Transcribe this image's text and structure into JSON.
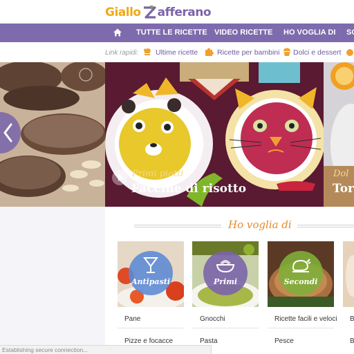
{
  "header": {
    "logo_part1": "Giallo",
    "logo_part2": "afferano",
    "brand_yellow": "#f0a818",
    "brand_purple": "#7b64a8"
  },
  "nav": {
    "home_icon": "home-icon",
    "items": [
      {
        "label": "TUTTE LE RICETTE"
      },
      {
        "label": "VIDEO RICETTE"
      },
      {
        "label": "HO VOGLIA DI"
      },
      {
        "label": "SO"
      }
    ],
    "background": "#7d6bad"
  },
  "quick_links": {
    "label": "Link rapidi:",
    "items": [
      {
        "label": "Ultime ricette",
        "icon": "chef-hat-icon"
      },
      {
        "label": "Ricette per bambini",
        "icon": "puzzle-icon"
      },
      {
        "label": "Dolci e dessert",
        "icon": "cupcake-icon"
      }
    ]
  },
  "carousel": {
    "main_category": "Primi piatti",
    "main_title": "Faccine di risotto",
    "right_category": "Dol",
    "right_title": "Tor"
  },
  "ho_voglia_di": {
    "title": "Ho voglia di",
    "cards": [
      {
        "label": "Antipasti",
        "color": "#5b8ad6",
        "icon": "cocktail-glass-icon"
      },
      {
        "label": "Primi",
        "color": "#7b64a8",
        "icon": "pasta-bowl-icon"
      },
      {
        "label": "Secondi",
        "color": "#7fae3a",
        "icon": "roast-chicken-icon"
      }
    ],
    "links_row1": [
      "Pane",
      "Gnocchi",
      "Ricette facili e veloci",
      "Bi"
    ],
    "links_row2": [
      "Pizze e focacce",
      "Pasta",
      "Pesce",
      "B"
    ]
  },
  "status": {
    "text": "Establishing secure connection..."
  }
}
